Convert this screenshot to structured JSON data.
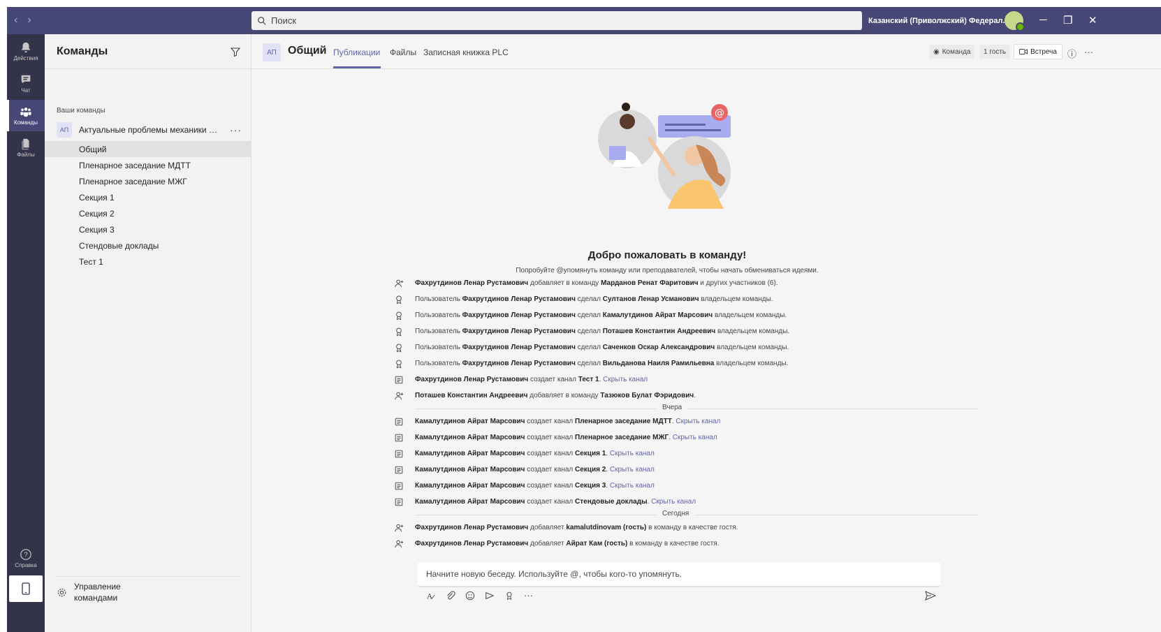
{
  "titlebar": {
    "search_placeholder": "Поиск",
    "org_name": "Казанский (Приволжский) Федерал...",
    "minimize": "─",
    "maximize": "❐",
    "close": "✕"
  },
  "rail": {
    "items": [
      {
        "label": "Действия",
        "icon": "bell-icon"
      },
      {
        "label": "Чат",
        "icon": "chat-icon"
      },
      {
        "label": "Команды",
        "icon": "teams-icon"
      },
      {
        "label": "Файлы",
        "icon": "files-icon"
      }
    ],
    "help_label": "Справка"
  },
  "teams_panel": {
    "title": "Команды",
    "section_label": "Ваши команды",
    "team": {
      "badge": "АП",
      "name": "Актуальные проблемы механики сп...",
      "more": "···"
    },
    "channels": [
      "Общий",
      "Пленарное заседание МДТТ",
      "Пленарное заседание МЖГ",
      "Секция 1",
      "Секция 2",
      "Секция 3",
      "Стендовые доклады",
      "Тест 1"
    ],
    "manage_label": "Управление командами"
  },
  "channel_header": {
    "badge": "АП",
    "title": "Общий",
    "tabs": [
      "Публикации",
      "Файлы",
      "Записная книжка PLC"
    ],
    "team_pill": "Команда",
    "guest_pill": "1 гость",
    "meet_button": "Встреча"
  },
  "welcome": {
    "title": "Добро пожаловать в команду!",
    "subtitle": "Попробуйте @упомянуть команду или преподавателей, чтобы начать обмениваться идеями."
  },
  "feed": {
    "group1": [
      {
        "icon": "add-person-icon",
        "parts": [
          [
            "b",
            "Фахрутдинов Ленар Рустамович"
          ],
          [
            "t",
            " добавляет в команду "
          ],
          [
            "b",
            "Марданов Ренат Фаритович"
          ],
          [
            "t",
            " и других участников (6)."
          ]
        ]
      },
      {
        "icon": "award-icon",
        "parts": [
          [
            "t",
            "Пользователь "
          ],
          [
            "b",
            "Фахрутдинов Ленар Рустамович"
          ],
          [
            "t",
            " сделал "
          ],
          [
            "b",
            "Султанов Ленар Усманович"
          ],
          [
            "t",
            " владельцем команды."
          ]
        ]
      },
      {
        "icon": "award-icon",
        "parts": [
          [
            "t",
            "Пользователь "
          ],
          [
            "b",
            "Фахрутдинов Ленар Рустамович"
          ],
          [
            "t",
            " сделал "
          ],
          [
            "b",
            "Камалутдинов Айрат Марсович"
          ],
          [
            "t",
            " владельцем команды."
          ]
        ]
      },
      {
        "icon": "award-icon",
        "parts": [
          [
            "t",
            "Пользователь "
          ],
          [
            "b",
            "Фахрутдинов Ленар Рустамович"
          ],
          [
            "t",
            " сделал "
          ],
          [
            "b",
            "Поташев Константин Андреевич"
          ],
          [
            "t",
            " владельцем команды."
          ]
        ]
      },
      {
        "icon": "award-icon",
        "parts": [
          [
            "t",
            "Пользователь "
          ],
          [
            "b",
            "Фахрутдинов Ленар Рустамович"
          ],
          [
            "t",
            " сделал "
          ],
          [
            "b",
            "Саченков Оскар Александрович"
          ],
          [
            "t",
            " владельцем команды."
          ]
        ]
      },
      {
        "icon": "award-icon",
        "parts": [
          [
            "t",
            "Пользователь "
          ],
          [
            "b",
            "Фахрутдинов Ленар Рустамович"
          ],
          [
            "t",
            " сделал "
          ],
          [
            "b",
            "Вильданова Наиля Рамильевна"
          ],
          [
            "t",
            " владельцем команды."
          ]
        ]
      },
      {
        "icon": "channel-icon",
        "parts": [
          [
            "b",
            "Фахрутдинов Ленар Рустамович"
          ],
          [
            "t",
            " создает канал "
          ],
          [
            "b",
            "Тест 1"
          ],
          [
            "t",
            "."
          ],
          [
            "l",
            " Скрыть канал"
          ]
        ]
      },
      {
        "icon": "add-person-icon",
        "parts": [
          [
            "b",
            "Поташев Константин Андреевич"
          ],
          [
            "t",
            " добавляет в команду "
          ],
          [
            "b",
            "Тазюков Булат Фэридович"
          ],
          [
            "t",
            "."
          ]
        ]
      }
    ],
    "sep1": "Вчера",
    "group2": [
      {
        "icon": "channel-icon",
        "parts": [
          [
            "b",
            "Камалутдинов Айрат Марсович"
          ],
          [
            "t",
            " создает канал "
          ],
          [
            "b",
            "Пленарное заседание МДТТ"
          ],
          [
            "t",
            "."
          ],
          [
            "l",
            " Скрыть канал"
          ]
        ]
      },
      {
        "icon": "channel-icon",
        "parts": [
          [
            "b",
            "Камалутдинов Айрат Марсович"
          ],
          [
            "t",
            " создает канал "
          ],
          [
            "b",
            "Пленарное заседание МЖГ"
          ],
          [
            "t",
            "."
          ],
          [
            "l",
            " Скрыть канал"
          ]
        ]
      },
      {
        "icon": "channel-icon",
        "parts": [
          [
            "b",
            "Камалутдинов Айрат Марсович"
          ],
          [
            "t",
            " создает канал "
          ],
          [
            "b",
            "Секция 1"
          ],
          [
            "t",
            "."
          ],
          [
            "l",
            " Скрыть канал"
          ]
        ]
      },
      {
        "icon": "channel-icon",
        "parts": [
          [
            "b",
            "Камалутдинов Айрат Марсович"
          ],
          [
            "t",
            " создает канал "
          ],
          [
            "b",
            "Секция 2"
          ],
          [
            "t",
            "."
          ],
          [
            "l",
            " Скрыть канал"
          ]
        ]
      },
      {
        "icon": "channel-icon",
        "parts": [
          [
            "b",
            "Камалутдинов Айрат Марсович"
          ],
          [
            "t",
            " создает канал "
          ],
          [
            "b",
            "Секция 3"
          ],
          [
            "t",
            "."
          ],
          [
            "l",
            " Скрыть канал"
          ]
        ]
      },
      {
        "icon": "channel-icon",
        "parts": [
          [
            "b",
            "Камалутдинов Айрат Марсович"
          ],
          [
            "t",
            " создает канал "
          ],
          [
            "b",
            "Стендовые доклады"
          ],
          [
            "t",
            "."
          ],
          [
            "l",
            " Скрыть канал"
          ]
        ]
      }
    ],
    "sep2": "Сегодня",
    "group3": [
      {
        "icon": "add-person-icon",
        "parts": [
          [
            "b",
            "Фахрутдинов Ленар Рустамович"
          ],
          [
            "t",
            " добавляет "
          ],
          [
            "b",
            "kamalutdinovam (гость)"
          ],
          [
            "t",
            " в команду в качестве гостя."
          ]
        ]
      },
      {
        "icon": "add-person-icon",
        "parts": [
          [
            "b",
            "Фахрутдинов Ленар Рустамович"
          ],
          [
            "t",
            " добавляет "
          ],
          [
            "b",
            "Айрат Кам (гость)"
          ],
          [
            "t",
            " в команду в качестве гостя."
          ]
        ]
      }
    ]
  },
  "compose": {
    "placeholder": "Начните новую беседу. Используйте @, чтобы кого-то упомянуть."
  },
  "colors": {
    "titlebar": "#464775",
    "rail": "#33344a",
    "accent": "#6264a7"
  }
}
